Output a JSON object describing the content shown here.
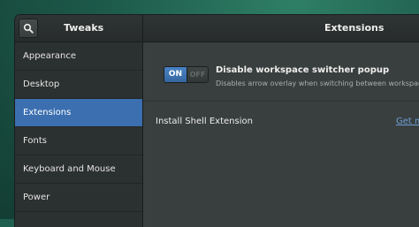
{
  "header": {
    "app_title": "Tweaks",
    "page_title": "Extensions",
    "search_icon": "search-icon"
  },
  "sidebar": {
    "items": [
      {
        "label": "Appearance",
        "selected": false
      },
      {
        "label": "Desktop",
        "selected": false
      },
      {
        "label": "Extensions",
        "selected": true
      },
      {
        "label": "Fonts",
        "selected": false
      },
      {
        "label": "Keyboard and Mouse",
        "selected": false
      },
      {
        "label": "Power",
        "selected": false
      }
    ]
  },
  "extension": {
    "switch_on_label": "ON",
    "switch_off_label": "OFF",
    "enabled": true,
    "title": "Disable workspace switcher popup",
    "description": "Disables arrow overlay when switching between workspaces"
  },
  "install": {
    "label": "Install Shell Extension",
    "link_text": "Get m"
  },
  "colors": {
    "selection": "#3b6fb0",
    "link": "#6ea0d8",
    "window_bg": "#393f3f"
  }
}
